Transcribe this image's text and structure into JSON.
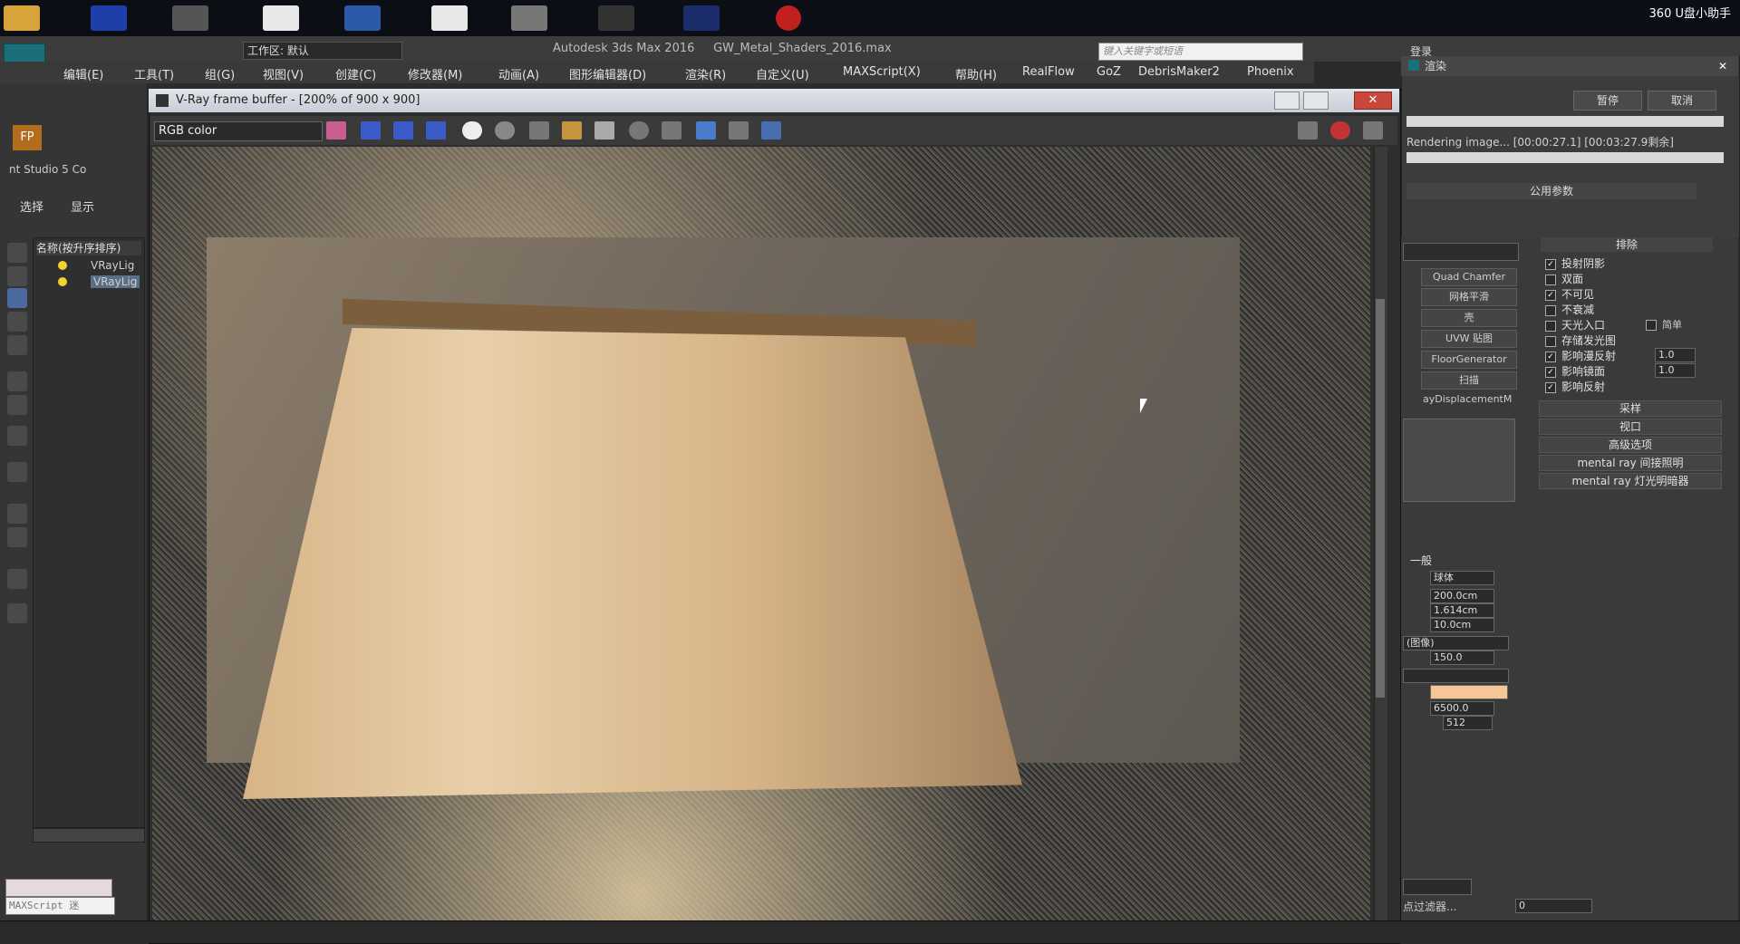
{
  "taskbar": {
    "right_label": "360 U盘小助手"
  },
  "max": {
    "workspace": "工作区: 默认",
    "app_title": "Autodesk 3ds Max 2016",
    "file_name": "GW_Metal_Shaders_2016.max",
    "search_placeholder": "键入关键字或短语",
    "login": "登录",
    "menus": [
      "编辑(E)",
      "工具(T)",
      "组(G)",
      "视图(V)",
      "创建(C)",
      "修改器(M)",
      "动画(A)",
      "图形编辑器(D)",
      "渲染(R)",
      "自定义(U)",
      "MAXScript(X)",
      "帮助(H)",
      "RealFlow",
      "GoZ",
      "DebrisMaker2",
      "Phoenix"
    ]
  },
  "left_panel": {
    "fp": "FP",
    "studio": "nt Studio 5 Co",
    "tab_select": "选择",
    "tab_display": "显示",
    "tree_header": "名称(按升序排序)",
    "tree_items": [
      "VRayLig",
      "VRayLig"
    ],
    "maxscript_label": "MAXScript 迷"
  },
  "vfb": {
    "title": "V-Ray frame buffer - [200% of 900 x 900]",
    "channel": "RGB color"
  },
  "render_dialog": {
    "title": "渲染",
    "pause": "暂停",
    "cancel": "取消",
    "status": "Rendering image... [00:00:27.1] [00:03:27.9剩余]",
    "common_params": "公用参数"
  },
  "modify_panel": {
    "buttons": [
      "Quad Chamfer",
      "网格平滑",
      "壳",
      "UVW 贴图",
      "FloorGenerator",
      "扫描"
    ],
    "displacement_label": "ayDisplacementM",
    "exclude": "排除",
    "checks": [
      {
        "label": "投射阴影",
        "checked": true
      },
      {
        "label": "双面",
        "checked": false
      },
      {
        "label": "不可见",
        "checked": true
      },
      {
        "label": "不衰减",
        "checked": false
      },
      {
        "label": "天光入口",
        "checked": false
      },
      {
        "label": "存储发光图",
        "checked": false
      },
      {
        "label": "影响漫反射",
        "checked": true
      },
      {
        "label": "影响镜面",
        "checked": true
      },
      {
        "label": "影响反射",
        "checked": true
      }
    ],
    "simple": "简单",
    "diffuse_val": "1.0",
    "specular_val": "1.0",
    "rollouts": [
      "采样",
      "视口",
      "高级选项",
      "mental ray 间接照明",
      "mental ray 灯光明暗器"
    ],
    "general": "一般",
    "type": "球体",
    "size1": "200.0cm",
    "size2": "1.614cm",
    "size3": "10.0cm",
    "mode": "(图像)",
    "multiplier": "150.0",
    "temp": "6500.0",
    "res": "512",
    "filter": "点过滤器...",
    "frame": "0"
  }
}
